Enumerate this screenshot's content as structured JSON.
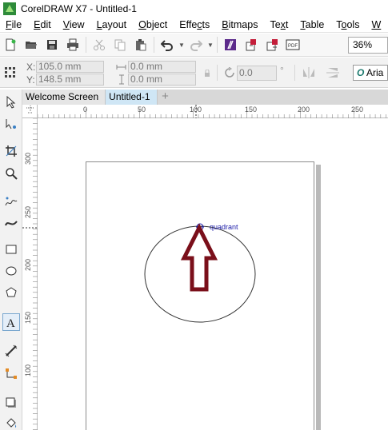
{
  "window": {
    "title": "CorelDRAW X7 - Untitled-1"
  },
  "menu": [
    {
      "pre": "",
      "u": "F",
      "post": "ile"
    },
    {
      "pre": "",
      "u": "E",
      "post": "dit"
    },
    {
      "pre": "",
      "u": "V",
      "post": "iew"
    },
    {
      "pre": "",
      "u": "L",
      "post": "ayout"
    },
    {
      "pre": "",
      "u": "O",
      "post": "bject"
    },
    {
      "pre": "Effe",
      "u": "c",
      "post": "ts"
    },
    {
      "pre": "",
      "u": "B",
      "post": "itmaps"
    },
    {
      "pre": "Te",
      "u": "x",
      "post": "t"
    },
    {
      "pre": "",
      "u": "T",
      "post": "able"
    },
    {
      "pre": "T",
      "u": "o",
      "post": "ols"
    },
    {
      "pre": "",
      "u": "W",
      "post": ""
    }
  ],
  "toolbar": {
    "zoom_value": "36%",
    "icons": [
      "new-document",
      "open",
      "save",
      "print",
      "cut",
      "copy",
      "paste",
      "undo",
      "redo",
      "corel-connect",
      "import",
      "export",
      "publish-pdf"
    ]
  },
  "property_bar": {
    "x_label": "X:",
    "x_value": "105.0 mm",
    "y_label": "Y:",
    "y_value": "148.5 mm",
    "width_value": "0.0 mm",
    "height_value": "0.0 mm",
    "rotation_value": "0.0",
    "degree_symbol": "°",
    "font_value": "Aria"
  },
  "tabs": [
    {
      "label": "Welcome Screen",
      "active": false
    },
    {
      "label": "Untitled-1",
      "active": true
    }
  ],
  "ruler": {
    "h_labels": [
      "0",
      "50",
      "100",
      "150",
      "200",
      "250"
    ],
    "v_labels": [
      "300",
      "250",
      "200",
      "150",
      "100"
    ]
  },
  "canvas": {
    "snap_label": "quadrant",
    "arrow_color": "#7a0f1a",
    "snap_color": "#1a1aa8"
  },
  "colors": {
    "accent": "#2f7fc1",
    "app_logo_green": "#3ab54a"
  }
}
